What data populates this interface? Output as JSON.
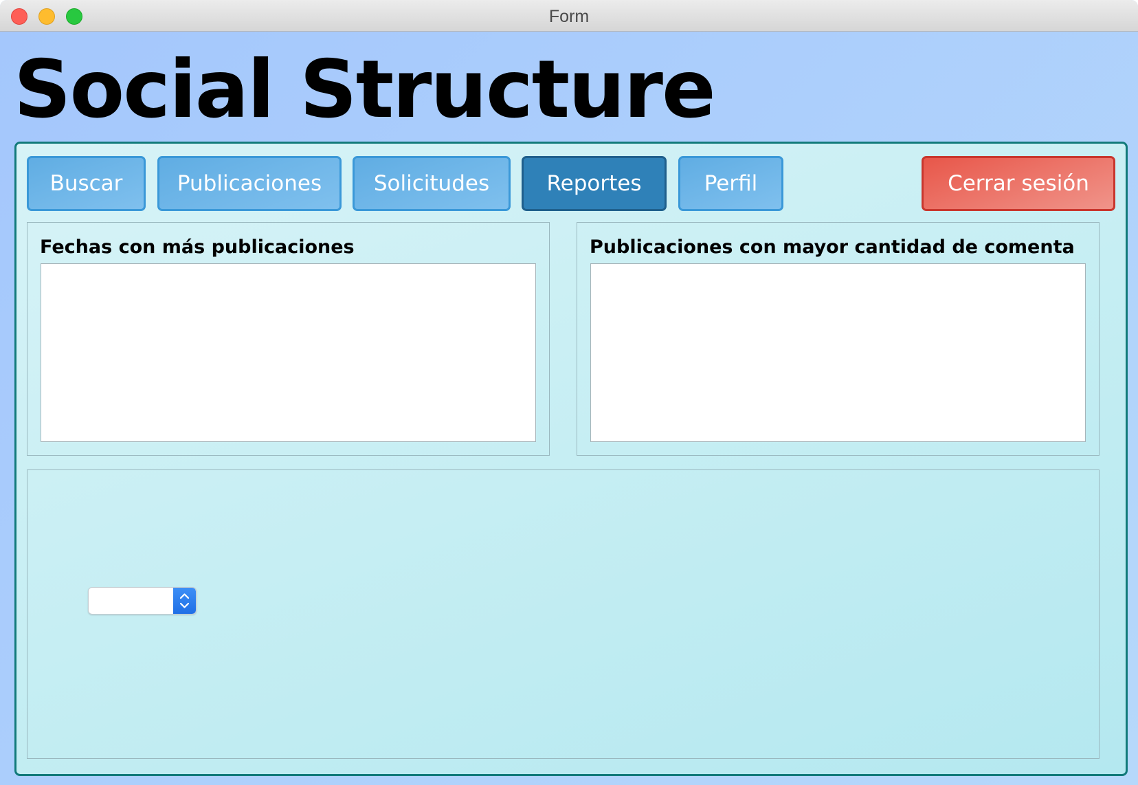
{
  "window": {
    "title": "Form"
  },
  "app": {
    "title": "Social Structure"
  },
  "nav": {
    "buttons": [
      {
        "label": "Buscar"
      },
      {
        "label": "Publicaciones"
      },
      {
        "label": "Solicitudes"
      },
      {
        "label": "Reportes"
      },
      {
        "label": "Perfil"
      }
    ],
    "active": "Reportes",
    "logout_label": "Cerrar sesión"
  },
  "reports": {
    "dates_panel": {
      "title": "Fechas con más publicaciones",
      "items": []
    },
    "comments_panel": {
      "title": "Publicaciones con mayor cantidad de comentarios",
      "items": []
    },
    "selector": {
      "value": ""
    }
  },
  "colors": {
    "background": "#a9cdfb",
    "panel_border": "#117a7a",
    "nav_button": "#60ade3",
    "nav_button_active": "#2f81b8",
    "logout_button": "#e8574a"
  }
}
